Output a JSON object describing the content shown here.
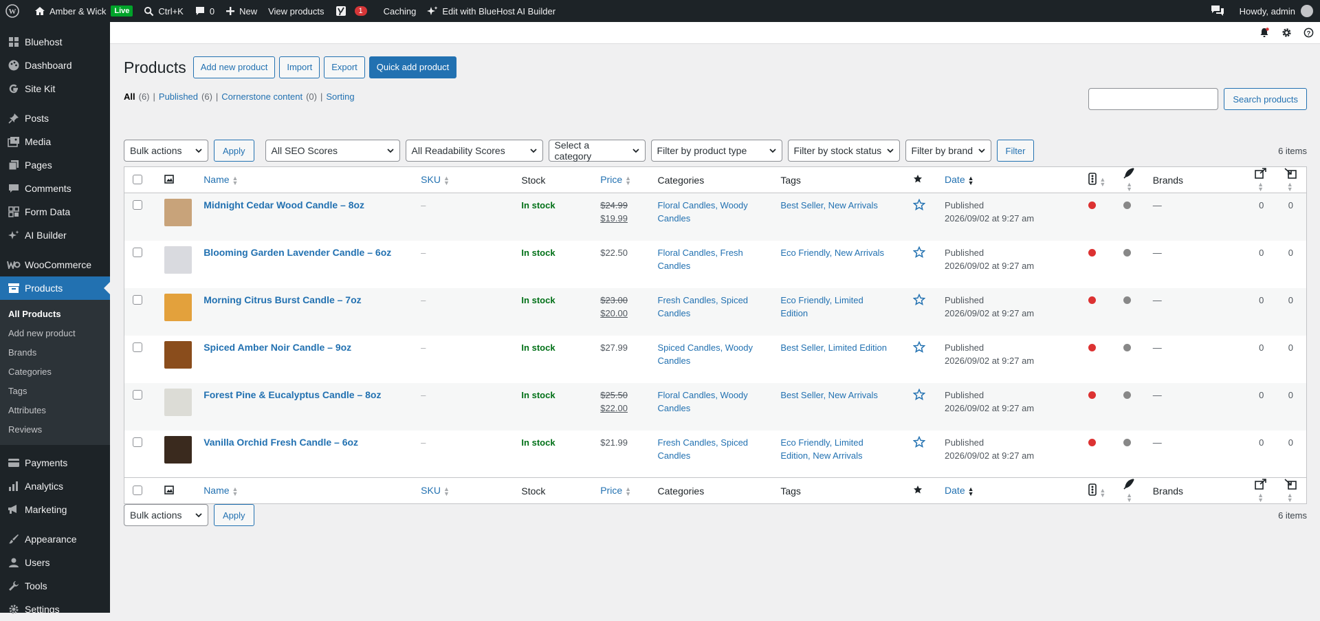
{
  "adminbar": {
    "site_name": "Amber & Wick",
    "live_label": "Live",
    "search_label": "Ctrl+K",
    "comments_count": "0",
    "new_label": "New",
    "view_products": "View products",
    "yoast_count": "1",
    "caching": "Caching",
    "ai_builder": "Edit with BlueHost AI Builder",
    "howdy": "Howdy, admin"
  },
  "sidebar": {
    "items_top": [
      {
        "label": "Bluehost",
        "icon": "grid-icon"
      },
      {
        "label": "Dashboard",
        "icon": "palette-icon"
      },
      {
        "label": "Site Kit",
        "icon": "google-icon"
      }
    ],
    "items_mid": [
      {
        "label": "Posts",
        "icon": "pin-icon"
      },
      {
        "label": "Media",
        "icon": "media-icon"
      },
      {
        "label": "Pages",
        "icon": "pages-icon"
      },
      {
        "label": "Comments",
        "icon": "comment-icon"
      },
      {
        "label": "Form Data",
        "icon": "form-icon"
      },
      {
        "label": "AI Builder",
        "icon": "sparkle-icon"
      }
    ],
    "woo": "WooCommerce",
    "products": "Products",
    "submenu": [
      "All Products",
      "Add new product",
      "Brands",
      "Categories",
      "Tags",
      "Attributes",
      "Reviews"
    ],
    "items_bottom": [
      {
        "label": "Payments",
        "icon": "payments-icon"
      },
      {
        "label": "Analytics",
        "icon": "analytics-icon"
      },
      {
        "label": "Marketing",
        "icon": "megaphone-icon"
      }
    ],
    "items_bottom2": [
      {
        "label": "Appearance",
        "icon": "brush-icon"
      },
      {
        "label": "Users",
        "icon": "user-icon"
      },
      {
        "label": "Tools",
        "icon": "wrench-icon"
      },
      {
        "label": "Settings",
        "icon": "settings-icon"
      }
    ]
  },
  "page": {
    "title": "Products",
    "add_new": "Add new product",
    "import": "Import",
    "export": "Export",
    "quick_add": "Quick add product",
    "filters": {
      "all": "All",
      "all_count": "(6)",
      "published": "Published",
      "published_count": "(6)",
      "cornerstone": "Cornerstone content",
      "cornerstone_count": "(0)",
      "sorting": "Sorting"
    },
    "search_button": "Search products",
    "bulk_actions": "Bulk actions",
    "apply": "Apply",
    "seo_scores": "All SEO Scores",
    "readability": "All Readability Scores",
    "category": "Select a category",
    "product_type": "Filter by product type",
    "stock_status": "Filter by stock status",
    "brand": "Filter by brand",
    "filter": "Filter",
    "items_count": "6 items"
  },
  "columns": {
    "name": "Name",
    "sku": "SKU",
    "stock": "Stock",
    "price": "Price",
    "categories": "Categories",
    "tags": "Tags",
    "date": "Date",
    "brands": "Brands"
  },
  "rows": [
    {
      "name": "Midnight Cedar Wood Candle – 8oz",
      "sku": "–",
      "stock": "In stock",
      "regular": "$24.99",
      "sale": "$19.99",
      "price": "",
      "cat1": "Floral Candles, Woody",
      "cat2": "Candles",
      "tag1": "Best Seller, New Arrivals",
      "tag2": "",
      "status": "Published",
      "date": "2026/09/02 at 9:27 am",
      "brand": "—",
      "links_out": "0",
      "links_in": "0",
      "thumb_color": "#c8a37a"
    },
    {
      "name": "Blooming Garden Lavender Candle – 6oz",
      "sku": "–",
      "stock": "In stock",
      "regular": "",
      "sale": "",
      "price": "$22.50",
      "cat1": "Floral Candles, Fresh",
      "cat2": "Candles",
      "tag1": "Eco Friendly, New Arrivals",
      "tag2": "",
      "status": "Published",
      "date": "2026/09/02 at 9:27 am",
      "brand": "—",
      "links_out": "0",
      "links_in": "0",
      "thumb_color": "#d9dadf"
    },
    {
      "name": "Morning Citrus Burst Candle – 7oz",
      "sku": "–",
      "stock": "In stock",
      "regular": "$23.00",
      "sale": "$20.00",
      "price": "",
      "cat1": "Fresh Candles, Spiced",
      "cat2": "Candles",
      "tag1": "Eco Friendly, Limited",
      "tag2": "Edition",
      "status": "Published",
      "date": "2026/09/02 at 9:27 am",
      "brand": "—",
      "links_out": "0",
      "links_in": "0",
      "thumb_color": "#e3a13c"
    },
    {
      "name": "Spiced Amber Noir Candle – 9oz",
      "sku": "–",
      "stock": "In stock",
      "regular": "",
      "sale": "",
      "price": "$27.99",
      "cat1": "Spiced Candles, Woody",
      "cat2": "Candles",
      "tag1": "Best Seller, Limited Edition",
      "tag2": "",
      "status": "Published",
      "date": "2026/09/02 at 9:27 am",
      "brand": "—",
      "links_out": "0",
      "links_in": "0",
      "thumb_color": "#8a4d1c"
    },
    {
      "name": "Forest Pine & Eucalyptus Candle – 8oz",
      "sku": "–",
      "stock": "In stock",
      "regular": "$25.50",
      "sale": "$22.00",
      "price": "",
      "cat1": "Floral Candles, Woody",
      "cat2": "Candles",
      "tag1": "Best Seller, New Arrivals",
      "tag2": "",
      "status": "Published",
      "date": "2026/09/02 at 9:27 am",
      "brand": "—",
      "links_out": "0",
      "links_in": "0",
      "thumb_color": "#dcdcd6"
    },
    {
      "name": "Vanilla Orchid Fresh Candle – 6oz",
      "sku": "–",
      "stock": "In stock",
      "regular": "",
      "sale": "",
      "price": "$21.99",
      "cat1": "Fresh Candles, Spiced",
      "cat2": "Candles",
      "tag1": "Eco Friendly, Limited",
      "tag2": "Edition, New Arrivals",
      "status": "Published",
      "date": "2026/09/02 at 9:27 am",
      "brand": "—",
      "links_out": "0",
      "links_in": "0",
      "thumb_color": "#3a2a1e"
    }
  ]
}
